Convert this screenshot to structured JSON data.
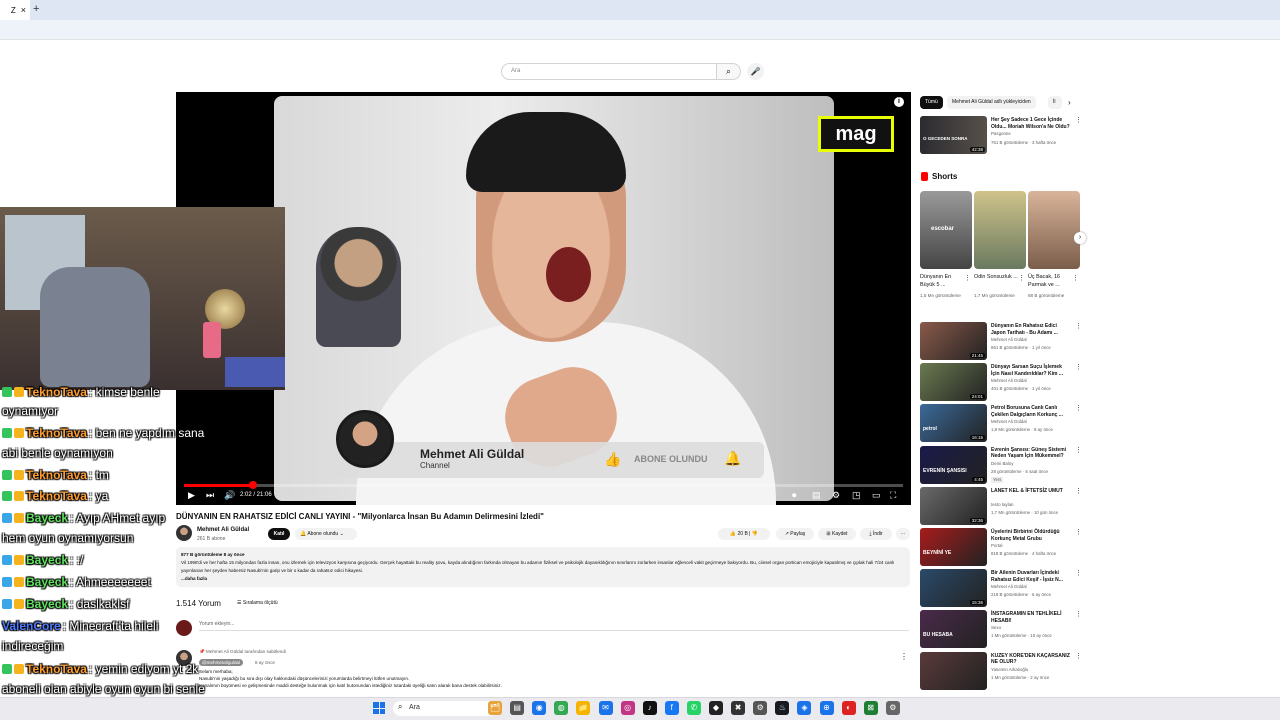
{
  "browser": {
    "tab_label": "Z",
    "tab_close": "×",
    "new_tab": "+"
  },
  "search": {
    "placeholder": "Ara",
    "button_icon": "⌕",
    "mic_icon": "🎤"
  },
  "video": {
    "logo_text": "mag",
    "info_icon": "i",
    "overlay": {
      "name": "Mehmet Ali Güldal",
      "channel_label": "Channel",
      "subscribe_label": "ABONE OLUNDU",
      "like_icon": "👍",
      "bell_icon": "🔔"
    },
    "progress_fraction": 0.096,
    "timer": "2:02 / 21:06",
    "controls": {
      "play": "▶",
      "next": "⏭",
      "volume": "🔊",
      "settings": "⚙",
      "theater": "▭",
      "miniplayer": "◳",
      "fullscreen": "⛶",
      "captions": "▤",
      "autoplay": "⏺"
    }
  },
  "chat": [
    {
      "user": "TeknoTava",
      "text": ": kimse benle",
      "color": "#ff9d2e",
      "badge": "#35c35b"
    },
    {
      "user": "",
      "text": "oynamıyor",
      "color": "#fff",
      "badge": ""
    },
    {
      "user": "TeknoTava",
      "text": ": ben ne yapdım sana",
      "color": "#ff9d2e",
      "badge": "#35c35b"
    },
    {
      "user": "",
      "text": "abi benle oynamıyon",
      "color": "#fff",
      "badge": ""
    },
    {
      "user": "TeknoTava",
      "text": ": tm",
      "color": "#ff9d2e",
      "badge": "#35c35b"
    },
    {
      "user": "TeknoTava",
      "text": ": ya",
      "color": "#ff9d2e",
      "badge": "#35c35b"
    },
    {
      "user": "Bayeck",
      "text": ": Ayıp AHmet ayıp",
      "color": "#5ee35e",
      "badge": "#3aa6e8"
    },
    {
      "user": "",
      "text": "hem oyun oynamıyorsun",
      "color": "#fff",
      "badge": ""
    },
    {
      "user": "Bayeck",
      "text": ": :/",
      "color": "#5ee35e",
      "badge": "#3aa6e8"
    },
    {
      "user": "Bayeck",
      "text": ": Ahmeeeeeeet",
      "color": "#5ee35e",
      "badge": "#3aa6e8"
    },
    {
      "user": "Bayeck",
      "text": ": daslkaklsf",
      "color": "#5ee35e",
      "badge": "#3aa6e8"
    },
    {
      "user": "ValenCore",
      "text": ": Minecraft'ta hileli",
      "color": "#4d7bff",
      "badge": ""
    },
    {
      "user": "",
      "text": "indireceğim",
      "color": "#fff",
      "badge": ""
    },
    {
      "user": "TeknoTava",
      "text": ": yemin ediyom yt 2k",
      "color": "#ff9d2e",
      "badge": "#35c35b"
    },
    {
      "user": "",
      "text": "aboneli olan abiyle oyun oyun bi senle",
      "color": "#fff",
      "badge": ""
    },
    {
      "user": "",
      "text": "oynayamadım ya",
      "color": "#fff",
      "badge": ""
    }
  ],
  "watch": {
    "title": "DÜNYANIN EN RAHATSIZ EDİCİ CANLI YAYINI - \"Milyonlarca İnsan Bu Adamın Delirmesini İzledi\"",
    "channel_name": "Mehmet Ali Güldal",
    "channel_subs": "261 B abone",
    "join_label": "Katıl",
    "subscribed_label": "Abone olundu",
    "like_count": "20 B",
    "share_label": "Paylaş",
    "save_label": "Kaydet",
    "download_label": "İndir",
    "more_label": "···",
    "desc_stats": "877 B görüntüleme  8 ay önce",
    "desc_text": "Vil 1998'di ve her hafta 15 milyondan fazla insan, onu izlemek için televizyon karşısına geçiyordu. Gerçek hayattaki bu reality şovu, kayda alındığının farkında olmayan bu adamın fiziksel ve psikolojik dayanıklılığının sınırlarını zorlarken insanlar eğlenceli vakit geçirmeye bakıyordu. Bu, ciinsel organ portican emojiciyle kapatılmış ve çıplak hali 7/24 canlı yayınlanan her şeyden habersiz Nasubi'nin garip ve bir o kadar da rahatsız edici hikayesi.",
    "desc_more": "...daha fazla",
    "comments_count": "1.514 Yorum",
    "sort_label": "Sıralama ölçütü",
    "comment_placeholder": "Yorum ekleyin...",
    "pinned_by": "Mehmet Ali Güldal tarafından sabitlendi",
    "pinned_user": "@mehmetaliguldal",
    "pinned_time": "8 ay önce",
    "pinned_text_1": "Selam merhaba;",
    "pinned_text_2": "Nasubi'nin yaşadığı bu sıra dışı olay hakkındaki düşüncelerinizi yorumlarda belirtmeyi lütfen unutmayın.",
    "pinned_text_3": "Kanalımın büyümesi ve gelişmesinde maddi desteğe bulunmak için katıl butonundan istediğiniz tutardaki üyeliği satın alarak bana destek olabilirsiniz."
  },
  "sidebar": {
    "chips": [
      "Tümü",
      "Mehmet Ali Güldal adlı yükleyiciden",
      "İl"
    ],
    "chip_next": "›",
    "top_video": {
      "title": "Her Şey Sadece 1 Gece İçinde Oldu... Moriah Wilson'a Ne Oldu?",
      "channel": "Pasgonne",
      "meta": "761 B görüntüleme · 3 hafta önce",
      "duration": "42:38",
      "thumb_text": "O GECEDEN SONRA"
    },
    "shorts_header": "Shorts",
    "shorts": [
      {
        "title": "Dünyanın En Büyük 5 ...",
        "views": "1,5 Mn görüntüleme",
        "thumb_text": "escobar"
      },
      {
        "title": "Odin Sonsuzluk ...",
        "views": "1,7 Mn görüntüleme",
        "thumb_text": ""
      },
      {
        "title": "Üç Bacak, 16 Parmak ve ...",
        "views": "68 B görüntüleme",
        "thumb_text": ""
      }
    ],
    "shorts_next": "›",
    "videos": [
      {
        "title": "Dünyanın En Rahatsız Edici Japon Tarihatı - Bu Adamı ...",
        "channel": "Mehmet Ali Güldal",
        "meta": "851 B görüntüleme · 1 yıl önce",
        "duration": "21:45",
        "thumb_text": ""
      },
      {
        "title": "Dünyayı Sarsan Suçu İşlemek İçin Nasıl Kandırıldılar? Kim ...",
        "channel": "Mehmet Ali Güldal",
        "meta": "401 B görüntüleme · 1 yıl önce",
        "duration": "24:01",
        "thumb_text": ""
      },
      {
        "title": "Petrol Borusuna Canlı Canlı Çekilen Dalgıçların Korkunç ...",
        "channel": "Mehmet Ali Güldal",
        "meta": "1,8 Mn görüntüleme · 9 ay önce",
        "duration": "16:15",
        "thumb_text": "petrol"
      },
      {
        "title": "Evrenin Şansısı: Güneş Sistemi Neden Yaşam İçin Mükemmel?",
        "channel": "Demi Baloy",
        "meta": "28 görüntüleme · 5 saat önce",
        "badge": "Yeni",
        "duration": "4:45",
        "thumb_text": "EVRENİN ŞANSISI"
      },
      {
        "title": "LANET KEL & İFTETSİZ UMUT",
        "channel": "testo taylan",
        "meta": "1,7 Mn görüntüleme · 10 gün önce",
        "duration": "32:36",
        "thumb_text": ""
      },
      {
        "title": "Üyelerini Birbirini Öldürdüğü Korkunç Metal Grubu",
        "channel": "Portal",
        "meta": "818 B görüntüleme · 4 hafta önce",
        "duration": "",
        "thumb_text": "BEYNİNİ YE"
      },
      {
        "title": "Bir Ailenin Duvarları İçindeki Rahatsız Edici Keşif - İşsiz N...",
        "channel": "Mehmet Ali Güldal",
        "meta": "218 B görüntüleme · 6 ay önce",
        "duration": "15:36",
        "thumb_text": ""
      },
      {
        "title": "İNSTAGRAMIN EN TEHLİKELİ HESABI!",
        "channel": "Sexo",
        "meta": "1 Mn görüntüleme · 10 ay önce",
        "duration": "",
        "thumb_text": "BU HESABA"
      },
      {
        "title": "KUZEY KORE'DEN KAÇARSANIZ NE OLUR?",
        "channel": "Yasemin Arkalıoğlu",
        "meta": "1 Mn görüntüleme · 2 ay önce",
        "duration": "",
        "thumb_text": ""
      }
    ],
    "more_icon": "⋮"
  },
  "taskbar": {
    "search_placeholder": "Ara",
    "search_icon": "⌕",
    "icons": [
      "🗂",
      "▤",
      "◉",
      "◍",
      "📁",
      "✉",
      "◎",
      "♪",
      "f",
      "✆",
      "◆",
      "✖",
      "⚙",
      "♨",
      "◈",
      "⊕",
      "◐",
      "⊠",
      "⚙"
    ]
  }
}
